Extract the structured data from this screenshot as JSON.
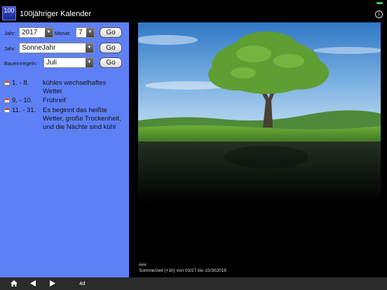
{
  "app": {
    "icon_text": "100",
    "title": "100jähriger Kalender"
  },
  "status": {
    "info_glyph": "i",
    "battery_color": "#3ad33a"
  },
  "filters": {
    "year_label": "Jahr:",
    "year_value": "2017",
    "month_label": "Monat:",
    "month_value": "7",
    "go_label": "Go",
    "year_type_label": "Jahr:",
    "year_type_value": "SonneJahr",
    "rules_label": "Bauernregeln:",
    "rules_value": "Juli"
  },
  "rules": [
    {
      "range": "1. - 8.",
      "text": "kühles wechselhaftes Wetter"
    },
    {
      "range": "9. - 10.",
      "text": "Frühreif"
    },
    {
      "range": "11. - 31.",
      "text": "Es beginnt das heißte Wetter, große Trockenheit, und die Nächte sind kühl"
    }
  ],
  "footer": {
    "line1": "###",
    "line2": "Sommerzeit (+1h) von 03/27 bis 10/302016"
  },
  "bottom_bar": {
    "view_mode": "4d"
  },
  "colors": {
    "left_panel": "#5e80f6",
    "background": "#000000",
    "bottom_bar": "#2b2b2b"
  }
}
